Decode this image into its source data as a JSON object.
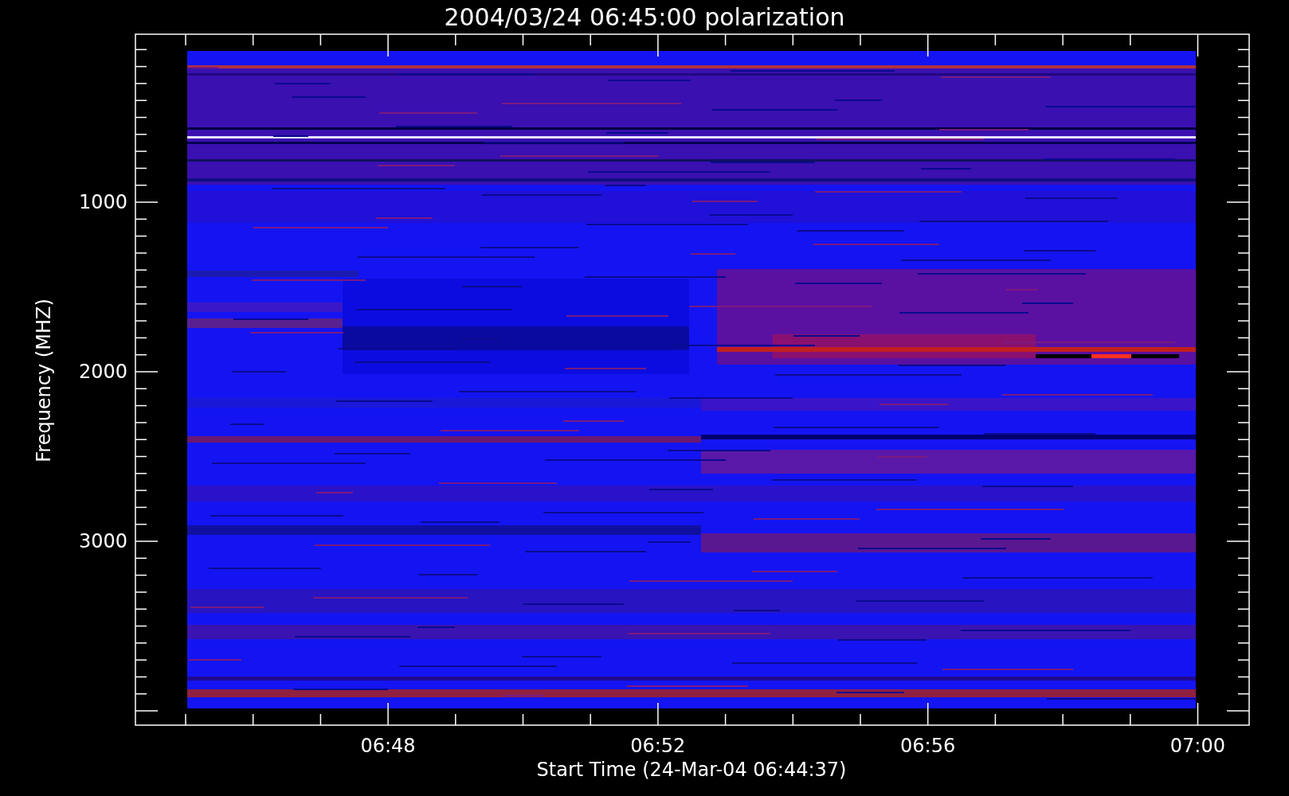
{
  "title": "2004/03/24 06:45:00 polarization",
  "y_axis": {
    "label": "Frequency (MHZ)",
    "ticks": [
      "1000",
      "2000",
      "3000"
    ]
  },
  "x_axis": {
    "label": "Start Time (24-Mar-04 06:44:37)",
    "ticks": [
      "06:48",
      "06:52",
      "06:56",
      "07:00"
    ]
  }
}
